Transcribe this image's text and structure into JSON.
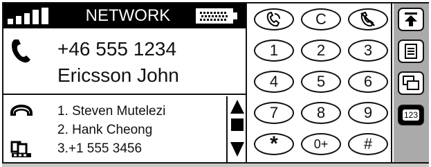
{
  "status_bar": {
    "network": "NETWORK",
    "signal_icon": "signal-bars-icon",
    "battery_icon": "battery-icon"
  },
  "call": {
    "number": "+46 555 1234",
    "name": "Ericsson John",
    "icon": "handset-icon"
  },
  "recent": {
    "items": [
      "1. Steven Mutelezi",
      "2. Hank Cheong",
      "3.+1 555 3456"
    ]
  },
  "keypad": {
    "rows": [
      [
        {
          "label": "",
          "icon": "call-icon"
        },
        {
          "label": "C"
        },
        {
          "label": "",
          "icon": "end-call-icon"
        }
      ],
      [
        {
          "label": "1"
        },
        {
          "label": "2"
        },
        {
          "label": "3"
        }
      ],
      [
        {
          "label": "4"
        },
        {
          "label": "5"
        },
        {
          "label": "6"
        }
      ],
      [
        {
          "label": "7"
        },
        {
          "label": "8"
        },
        {
          "label": "9"
        }
      ],
      [
        {
          "label": "*"
        },
        {
          "label": "0+"
        },
        {
          "label": "#"
        }
      ]
    ]
  },
  "toolbar": {
    "mode_label": "123"
  },
  "colors": {
    "frame": "#111111",
    "status_bar": "#000000",
    "toolbar_bg": "#aaaaaa",
    "bottom_strip": "#c8c8c8"
  }
}
